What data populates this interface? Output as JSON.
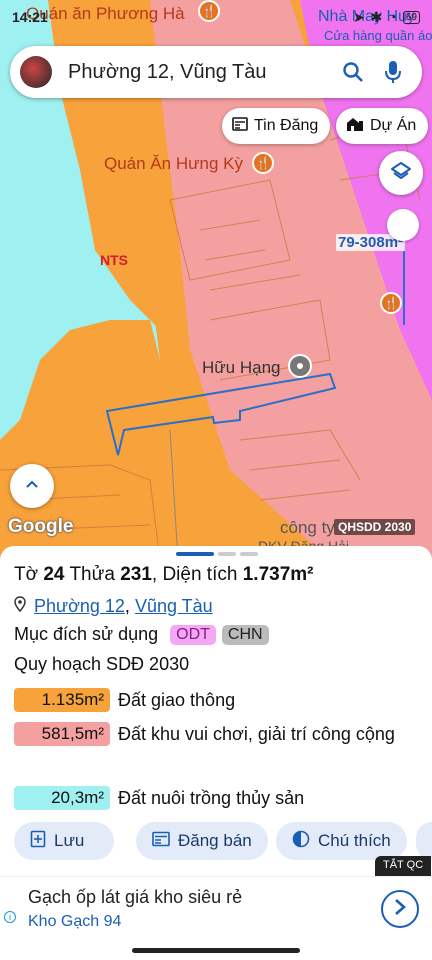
{
  "status_bar": {
    "time": "14:21",
    "battery": "69"
  },
  "search": {
    "query": "Phường 12, Vũng Tàu"
  },
  "chips": {
    "tin_dang": "Tin Đăng",
    "du_an": "Dự Án"
  },
  "map": {
    "labels": {
      "top_left": "Quán ăn Phương Hà",
      "top_right": "Nhà May Huy",
      "top_right_sub": "Cửa hàng quần áo",
      "restaurant": "Quán Ăn Hưng Kỳ",
      "nts": "NTS",
      "pin": "Hữu Hạng",
      "company": "công ty",
      "company_sub": "DKV Đăng Hải"
    },
    "scale": "79-308m²",
    "google": "Google",
    "qhsdd": "QHSDD 2030",
    "colors": {
      "residential": "#f7a23a",
      "road": "#f5a0a0",
      "aqua": "#9ff0f0",
      "magenta": "#f074f0",
      "parcel_line": "#2a6fc8"
    }
  },
  "sheet": {
    "to_label": "Tờ",
    "to_value": "24",
    "thua_label": "Thửa",
    "thua_value": "231",
    "area_label": ", Diện tích",
    "area_value": "1.737m²",
    "ward": "Phường 12",
    "comma": ",",
    "city": "Vũng Tàu",
    "purpose_label": "Mục đích sử dụng",
    "purpose_tags": [
      "ODT",
      "CHN"
    ],
    "plan_title": "Quy hoạch SDĐ 2030",
    "zones": [
      {
        "area": "1.135m²",
        "desc": "Đất giao thông",
        "color": "#f7a23a"
      },
      {
        "area": "581,5m²",
        "desc": "Đất khu vui chơi, giải trí công cộng",
        "color": "#f5a0a0"
      },
      {
        "area": "20,3m²",
        "desc": "Đất nuôi trồng thủy sản",
        "color": "#9ff0f0"
      }
    ],
    "actions": {
      "save": "Lưu",
      "sell": "Đăng bán",
      "legend": "Chú thích"
    }
  },
  "ad": {
    "close": "TẮT QC",
    "headline": "Gạch ốp lát giá kho siêu rẻ",
    "advertiser": "Kho Gạch 94"
  }
}
